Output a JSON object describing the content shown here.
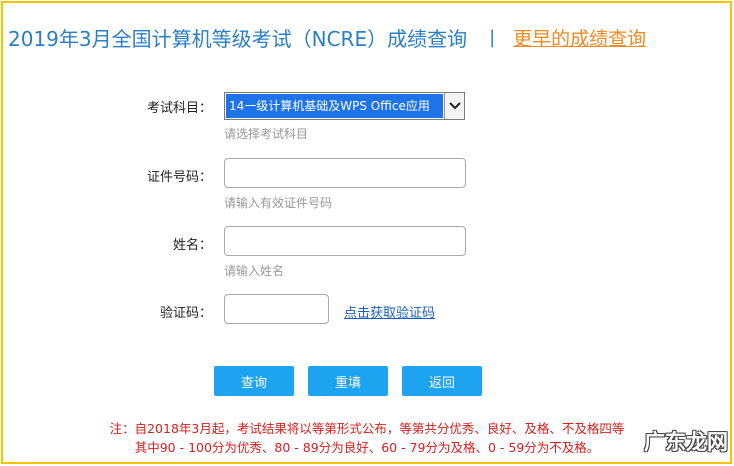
{
  "header": {
    "title": "2019年3月全国计算机等级考试（NCRE）成绩查询",
    "separator": "|",
    "early_link": "更早的成绩查询"
  },
  "form": {
    "subject": {
      "label": "考试科目：",
      "selected": "14一级计算机基础及WPS Office应用",
      "hint": "请选择考试科目"
    },
    "id_number": {
      "label": "证件号码：",
      "value": "",
      "hint": "请输入有效证件号码"
    },
    "name": {
      "label": "姓名：",
      "value": "",
      "hint": "请输入姓名"
    },
    "captcha": {
      "label": "验证码：",
      "value": "",
      "link": "点击获取验证码"
    }
  },
  "buttons": {
    "query": "查询",
    "reset": "重填",
    "back": "返回"
  },
  "notice": {
    "line1": "注：自2018年3月起，考试结果将以等第形式公布，等第共分优秀、良好、及格、不及格四等",
    "line2": "其中90 - 100分为优秀、80 - 89分为良好、60 - 79分为及格、0 - 59分为不及格。"
  },
  "watermark": "广东龙网",
  "colors": {
    "border": "#f5c400",
    "title": "#2a7fc4",
    "link_orange": "#f08a22",
    "button": "#1ea3f0",
    "notice": "#d81e1e"
  }
}
